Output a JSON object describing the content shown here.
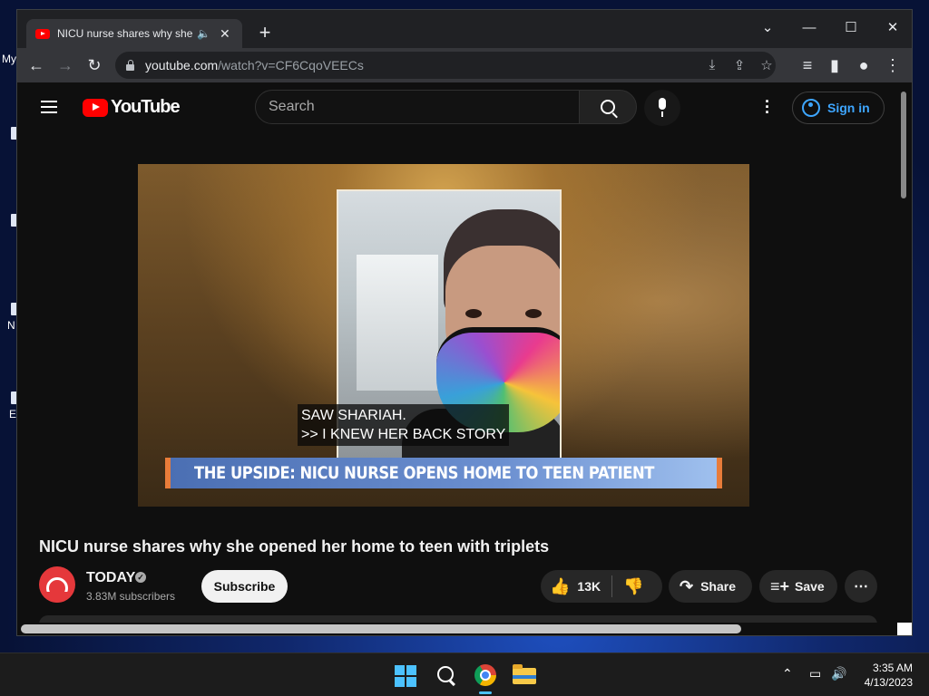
{
  "desktop": {
    "fragments": [
      "My",
      "N",
      "E"
    ]
  },
  "browser": {
    "tab_title": "NICU nurse shares why she o",
    "tab_audio_icon": "speaker-icon",
    "new_tab_label": "+",
    "url_host": "youtube.com",
    "url_path": "/watch?v=CF6CqoVEECs",
    "window_controls": [
      "⌄",
      "—",
      "☐",
      "✕"
    ]
  },
  "youtube": {
    "logo_text": "YouTube",
    "search_placeholder": "Search",
    "signin_label": "Sign in",
    "video": {
      "caption_text": "SAW SHARIAH.\n>> I KNEW HER BACK STORY",
      "lower_third": "THE UPSIDE: NICU NURSE OPENS HOME TO TEEN PATIENT",
      "title": "NICU nurse shares why she opened her home to teen with triplets"
    },
    "channel": {
      "name": "TODAY",
      "verified_mark": "✓",
      "subscribers": "3.83M subscribers",
      "subscribe_label": "Subscribe"
    },
    "actions": {
      "likes": "13K",
      "share_label": "Share",
      "save_label": "Save",
      "more_label": "⋯"
    }
  },
  "taskbar": {
    "time": "3:35 AM",
    "date": "4/13/2023"
  },
  "colors": {
    "yt_red": "#ff0000",
    "signin_blue": "#3ea6ff",
    "page_bg": "#0f0f0f",
    "chrome_frame": "#202124"
  }
}
